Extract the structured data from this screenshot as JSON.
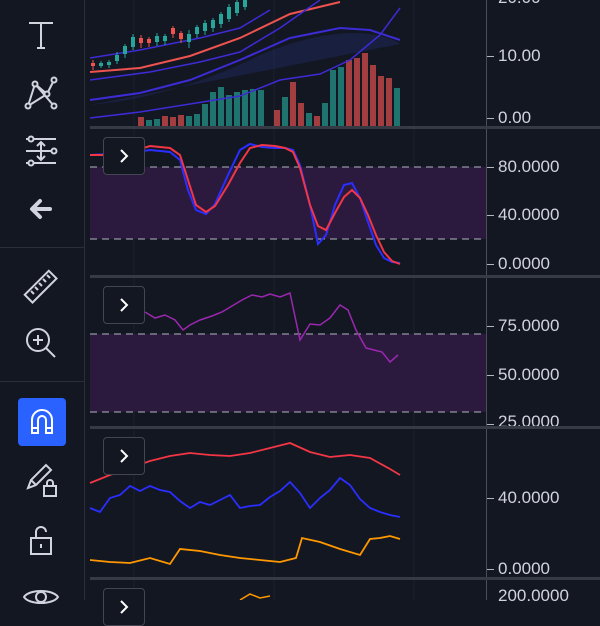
{
  "toolbar": {
    "tools": [
      {
        "name": "text-tool",
        "icon": "text-icon"
      },
      {
        "name": "pattern-tool",
        "icon": "xabcd-pattern-icon"
      },
      {
        "name": "prediction-tool",
        "icon": "long-short-position-icon"
      },
      {
        "name": "back-tool",
        "icon": "arrow-left-icon"
      },
      {
        "name": "ruler-tool",
        "icon": "ruler-icon"
      },
      {
        "name": "zoom-tool",
        "icon": "zoom-in-icon"
      },
      {
        "name": "magnet-tool",
        "icon": "magnet-icon",
        "active": true
      },
      {
        "name": "lock-drawings-tool",
        "icon": "pencil-lock-icon"
      },
      {
        "name": "lock-all-tool",
        "icon": "unlock-icon"
      },
      {
        "name": "hide-tool",
        "icon": "eye-icon"
      }
    ]
  },
  "colors": {
    "background": "#131722",
    "accent": "#2962ff",
    "up": "#26a69a",
    "down": "#ef5350",
    "red_line": "#f23645",
    "blue_line": "#2a2eff",
    "purple_line": "#9c27b0",
    "orange_line": "#ff9800",
    "band_fill": "#3a1a4a"
  },
  "price_pane": {
    "axis_labels": [
      "20.00",
      "10.00",
      "0.00"
    ]
  },
  "stoch_pane": {
    "axis_labels": [
      "80.0000",
      "40.0000",
      "0.0000"
    ],
    "upper_band": 80,
    "lower_band": 20
  },
  "rsi_pane": {
    "axis_labels": [
      "75.0000",
      "50.0000",
      "25.0000"
    ],
    "upper_band": 70,
    "lower_band": 30
  },
  "dmi_pane": {
    "axis_labels": [
      "40.0000",
      "0.0000"
    ]
  },
  "bottom_pane": {
    "axis_labels": [
      "200.0000"
    ]
  }
}
